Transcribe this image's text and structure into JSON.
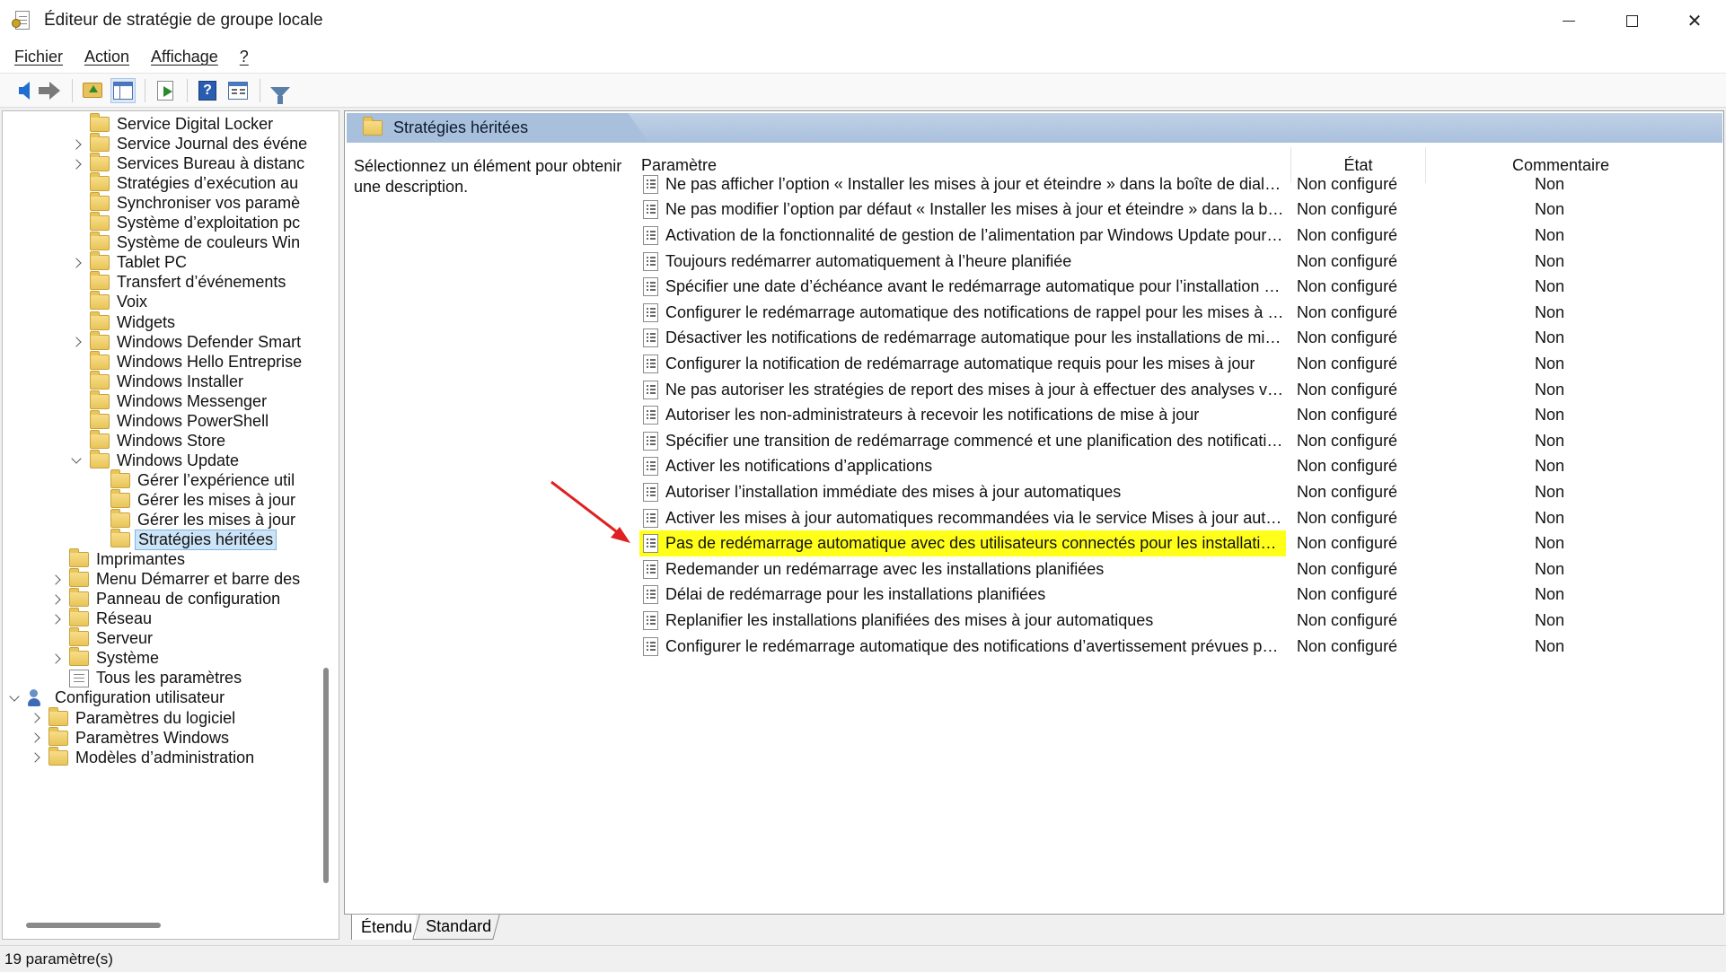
{
  "window": {
    "title": "Éditeur de stratégie de groupe locale",
    "controls": {
      "minimize": "minimize-icon",
      "maximize": "maximize-icon",
      "close": "✕"
    }
  },
  "menu": {
    "items": [
      "Fichier",
      "Action",
      "Affichage",
      "?"
    ]
  },
  "toolbar": {
    "icons": [
      "back-arrow-icon",
      "forward-arrow-icon",
      "folder-up-icon",
      "show-hide-tree-icon",
      "export-list-icon",
      "help-icon",
      "extended-view-icon",
      "filter-icon"
    ]
  },
  "tree": {
    "items": [
      {
        "label": "Service Digital Locker",
        "expander": "none",
        "icon": "folder-icon"
      },
      {
        "label": "Service Journal des événe",
        "expander": "right",
        "icon": "folder-icon"
      },
      {
        "label": "Services Bureau à distanc",
        "expander": "right",
        "icon": "folder-icon"
      },
      {
        "label": "Stratégies d’exécution au",
        "expander": "none",
        "icon": "folder-icon"
      },
      {
        "label": "Synchroniser vos paramè",
        "expander": "none",
        "icon": "folder-icon"
      },
      {
        "label": "Système d’exploitation pc",
        "expander": "none",
        "icon": "folder-icon"
      },
      {
        "label": "Système de couleurs Win",
        "expander": "none",
        "icon": "folder-icon"
      },
      {
        "label": "Tablet PC",
        "expander": "right",
        "icon": "folder-icon"
      },
      {
        "label": "Transfert d’événements",
        "expander": "none",
        "icon": "folder-icon"
      },
      {
        "label": "Voix",
        "expander": "none",
        "icon": "folder-icon"
      },
      {
        "label": "Widgets",
        "expander": "none",
        "icon": "folder-icon"
      },
      {
        "label": "Windows Defender Smart",
        "expander": "right",
        "icon": "folder-icon"
      },
      {
        "label": "Windows Hello Entreprise",
        "expander": "none",
        "icon": "folder-icon"
      },
      {
        "label": "Windows Installer",
        "expander": "none",
        "icon": "folder-icon"
      },
      {
        "label": "Windows Messenger",
        "expander": "none",
        "icon": "folder-icon"
      },
      {
        "label": "Windows PowerShell",
        "expander": "none",
        "icon": "folder-icon"
      },
      {
        "label": "Windows Store",
        "expander": "none",
        "icon": "folder-icon"
      },
      {
        "label": "Windows Update",
        "expander": "down",
        "icon": "folder-icon"
      },
      {
        "label": "Gérer l’expérience util",
        "expander": "none",
        "icon": "folder-icon"
      },
      {
        "label": "Gérer les mises à jour",
        "expander": "none",
        "icon": "folder-icon"
      },
      {
        "label": "Gérer les mises à jour",
        "expander": "none",
        "icon": "folder-icon"
      },
      {
        "label": "Stratégies héritées",
        "expander": "none",
        "icon": "folder-icon",
        "selected": true
      },
      {
        "label": "Imprimantes",
        "expander": "none",
        "icon": "folder-icon"
      },
      {
        "label": "Menu Démarrer et barre des",
        "expander": "right",
        "icon": "folder-icon"
      },
      {
        "label": "Panneau de configuration",
        "expander": "right",
        "icon": "folder-icon"
      },
      {
        "label": "Réseau",
        "expander": "right",
        "icon": "folder-icon"
      },
      {
        "label": "Serveur",
        "expander": "none",
        "icon": "folder-icon"
      },
      {
        "label": "Système",
        "expander": "right",
        "icon": "folder-icon"
      },
      {
        "label": "Tous les paramètres",
        "expander": "none",
        "icon": "all-settings-icon"
      },
      {
        "label": "Configuration utilisateur",
        "expander": "down",
        "icon": "users-icon"
      },
      {
        "label": "Paramètres du logiciel",
        "expander": "right",
        "icon": "folder-icon"
      },
      {
        "label": "Paramètres Windows",
        "expander": "right",
        "icon": "folder-icon"
      },
      {
        "label": "Modèles d’administration",
        "expander": "right",
        "icon": "folder-icon"
      }
    ]
  },
  "details": {
    "header_title": "Stratégies héritées",
    "description": "Sélectionnez un élément pour obtenir une description.",
    "columns": {
      "param": "Paramètre",
      "state": "État",
      "comment": "Commentaire"
    },
    "rows": [
      {
        "param": "Ne pas afficher l’option « Installer les mises à jour et éteindre » dans la boîte de dialogue Ar...",
        "state": "Non configuré",
        "comment": "Non"
      },
      {
        "param": "Ne pas modifier l’option par défaut « Installer les mises à jour et éteindre » dans la boîte de...",
        "state": "Non configuré",
        "comment": "Non"
      },
      {
        "param": "Activation de la fonctionnalité de gestion de l’alimentation par Windows Update pour la so...",
        "state": "Non configuré",
        "comment": "Non"
      },
      {
        "param": "Toujours redémarrer automatiquement à l’heure planifiée",
        "state": "Non configuré",
        "comment": "Non"
      },
      {
        "param": "Spécifier une date d’échéance avant le redémarrage automatique pour l’installation de la m...",
        "state": "Non configuré",
        "comment": "Non"
      },
      {
        "param": "Configurer le redémarrage automatique des notifications de rappel pour les mises à jour",
        "state": "Non configuré",
        "comment": "Non"
      },
      {
        "param": "Désactiver les notifications de redémarrage automatique pour les installations de mise à jour",
        "state": "Non configuré",
        "comment": "Non"
      },
      {
        "param": "Configurer la notification de redémarrage automatique requis pour les mises à jour",
        "state": "Non configuré",
        "comment": "Non"
      },
      {
        "param": "Ne pas autoriser les stratégies de report des mises à jour à effectuer des analyses vis-à-vis d...",
        "state": "Non configuré",
        "comment": "Non"
      },
      {
        "param": "Autoriser les non-administrateurs à recevoir les notifications de mise à jour",
        "state": "Non configuré",
        "comment": "Non"
      },
      {
        "param": "Spécifier une transition de redémarrage commencé et une planification des notifications de...",
        "state": "Non configuré",
        "comment": "Non"
      },
      {
        "param": "Activer les notifications d’applications",
        "state": "Non configuré",
        "comment": "Non"
      },
      {
        "param": "Autoriser l’installation immédiate des mises à jour automatiques",
        "state": "Non configuré",
        "comment": "Non"
      },
      {
        "param": "Activer les mises à jour automatiques recommandées via le service Mises à jour automatiques",
        "state": "Non configuré",
        "comment": "Non"
      },
      {
        "param": "Pas de redémarrage automatique avec des utilisateurs connectés pour les installations plani...",
        "state": "Non configuré",
        "comment": "Non",
        "highlight": true
      },
      {
        "param": "Redemander un redémarrage avec les installations planifiées",
        "state": "Non configuré",
        "comment": "Non"
      },
      {
        "param": "Délai de redémarrage pour les installations planifiées",
        "state": "Non configuré",
        "comment": "Non"
      },
      {
        "param": "Replanifier les installations planifiées des mises à jour automatiques",
        "state": "Non configuré",
        "comment": "Non"
      },
      {
        "param": "Configurer le redémarrage automatique des notifications d’avertissement prévues pour les ...",
        "state": "Non configuré",
        "comment": "Non"
      }
    ],
    "highlight_color": "#ffff1a",
    "annotation_arrow_color": "#e02020"
  },
  "tabs": [
    "Étendu",
    "Standard"
  ],
  "status": {
    "text": "19 paramètre(s)"
  }
}
